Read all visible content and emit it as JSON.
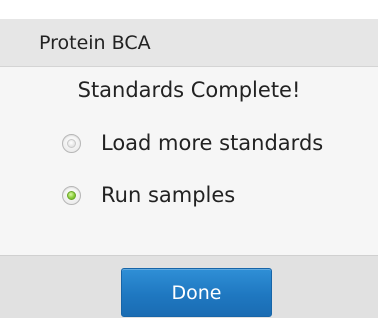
{
  "dialog": {
    "title": "Protein BCA",
    "message": "Standards Complete!"
  },
  "options": [
    {
      "label": "Load more standards",
      "selected": false
    },
    {
      "label": "Run samples",
      "selected": true
    }
  ],
  "footer": {
    "done_label": "Done"
  },
  "colors": {
    "accent": "#1f78c1",
    "radio_selected": "#8ccf3b"
  }
}
